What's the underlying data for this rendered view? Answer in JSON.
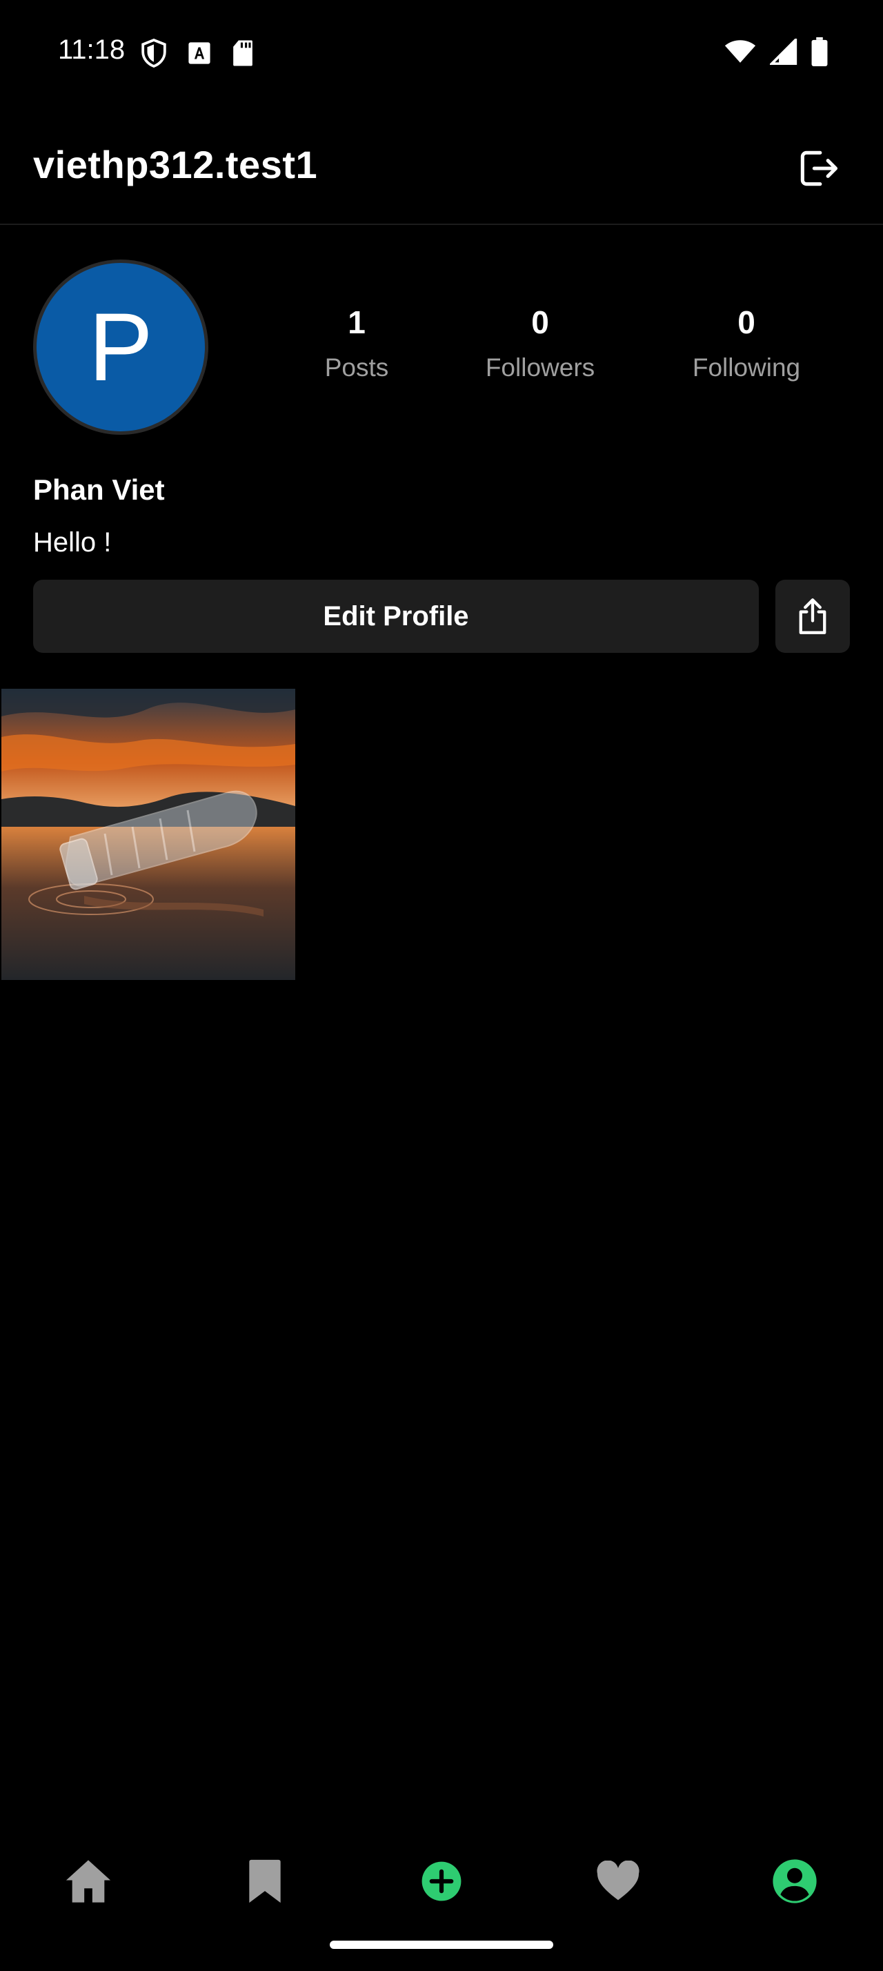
{
  "status_bar": {
    "time": "11:18",
    "left_icons": [
      "shield-icon",
      "font-download-icon",
      "sd-card-icon"
    ],
    "right_icons": [
      "wifi-icon",
      "cell-signal-icon",
      "battery-icon"
    ]
  },
  "header": {
    "username": "viethp312.test1",
    "logout_icon": "logout-icon"
  },
  "profile": {
    "avatar_initial": "P",
    "avatar_color": "#0a5ba6",
    "display_name": "Phan Viet",
    "bio": "Hello !",
    "stats": {
      "posts": {
        "value": "1",
        "label": "Posts"
      },
      "followers": {
        "value": "0",
        "label": "Followers"
      },
      "following": {
        "value": "0",
        "label": "Following"
      }
    },
    "edit_button_label": "Edit Profile",
    "share_icon": "share-icon"
  },
  "posts": [
    {
      "thumbnail": "bottle-on-water-sunset-photo"
    }
  ],
  "bottom_nav": {
    "items": [
      "home-icon",
      "bookmark-icon",
      "add-post-icon",
      "heart-icon",
      "profile-icon"
    ],
    "active": "profile-icon",
    "accent_color": "#2ecc71",
    "inactive_color": "#a0a0a0"
  }
}
